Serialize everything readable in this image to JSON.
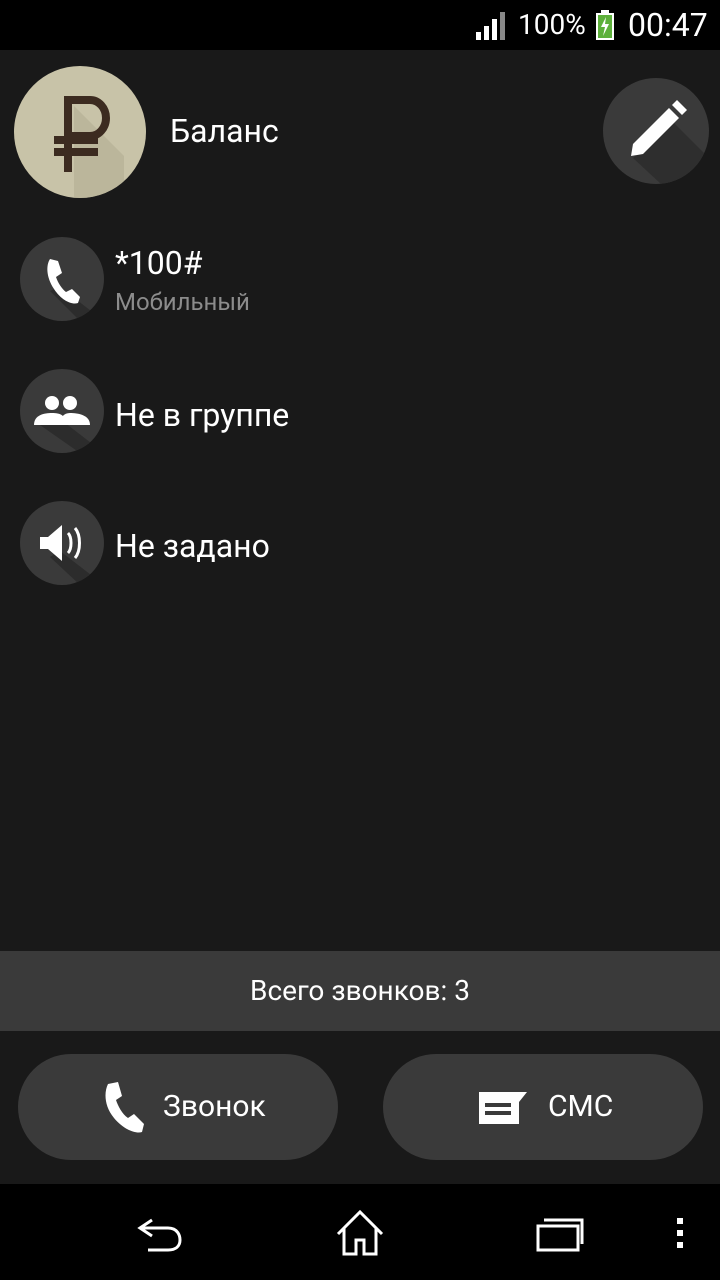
{
  "status_bar": {
    "battery_percent": "100%",
    "time": "00:47",
    "icons": [
      "signal-icon",
      "battery-charging-icon"
    ]
  },
  "contact": {
    "name": "Баланс",
    "avatar_icon": "ruble-icon",
    "avatar_color": "#c8c3a8",
    "edit_icon": "pencil-icon"
  },
  "details": [
    {
      "icon": "phone-icon",
      "primary": "*100#",
      "secondary": "Мобильный"
    },
    {
      "icon": "group-icon",
      "primary": "Не в группе"
    },
    {
      "icon": "speaker-icon",
      "primary": "Не задано"
    }
  ],
  "calls_summary": "Всего звонков: 3",
  "actions": {
    "call_label": "Звонок",
    "call_icon": "phone-icon",
    "sms_label": "СМС",
    "sms_icon": "message-icon"
  },
  "nav": {
    "icons": [
      "back-icon",
      "home-icon",
      "recents-icon",
      "overflow-menu-icon"
    ]
  },
  "colors": {
    "background": "#191919",
    "surface": "#3a3a3a",
    "secondary_text": "#8c8c8c",
    "bars": "#000000"
  }
}
